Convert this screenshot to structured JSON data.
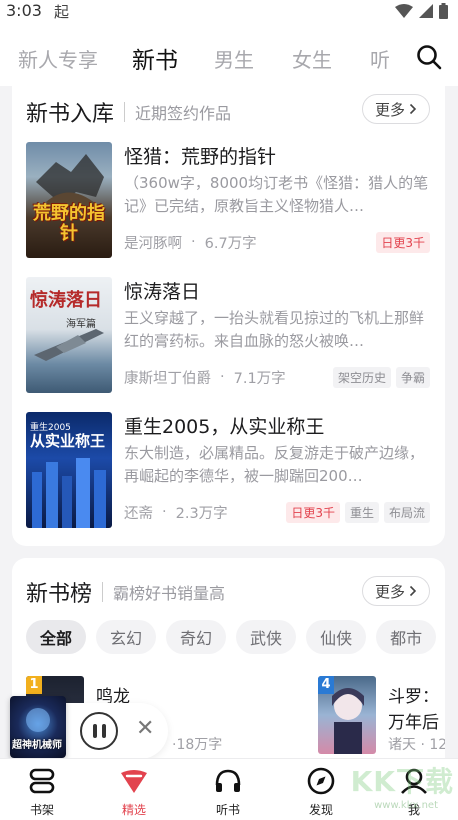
{
  "status": {
    "time": "3:03",
    "app_glyph": "起"
  },
  "tabs": [
    "新人专享",
    "新书",
    "男生",
    "女生",
    "听"
  ],
  "active_tab": "新书",
  "new_books": {
    "title": "新书入库",
    "subtitle": "近期签约作品",
    "more_label": "更多",
    "items": [
      {
        "title": "怪猎：荒野的指针",
        "desc": "（360w字，8000均订老书《怪猎：猎人的笔记》已完结，原教旨主义怪物猎人…",
        "author": "是河豚啊",
        "words": "6.7万字",
        "tags": [
          "日更3千"
        ],
        "cover_text": "荒野的指针"
      },
      {
        "title": "惊涛落日",
        "desc": "王义穿越了，一抬头就看见掠过的飞机上那鲜红的膏药标。来自血脉的怒火被唤…",
        "author": "康斯坦丁伯爵",
        "words": "7.1万字",
        "tags": [
          "架空历史",
          "争霸"
        ],
        "cover_text": "惊涛落日",
        "cover_sub": "海军篇"
      },
      {
        "title": "重生2005，从实业称王",
        "desc": "东大制造，必属精品。反复游走于破产边缘，再崛起的李德华，被一脚踹回200…",
        "author": "还斋",
        "words": "2.3万字",
        "tags": [
          "日更3千",
          "重生",
          "布局流"
        ],
        "cover_text": "从实业称王",
        "cover_sub": "重生2005"
      }
    ]
  },
  "rank": {
    "title": "新书榜",
    "subtitle": "霸榜好书销量高",
    "more_label": "更多",
    "chips": [
      "全部",
      "玄幻",
      "奇幻",
      "武侠",
      "仙侠",
      "都市"
    ],
    "active_chip": "全部",
    "left_item": {
      "rank": "1",
      "title": "鸣龙",
      "meta": "·18万字"
    },
    "right_item": {
      "rank": "4",
      "title": "斗罗：",
      "title2": "万年后",
      "meta": "诸天 · 12"
    }
  },
  "player": {
    "cover_text": "超神机械师"
  },
  "bottom_nav": [
    {
      "label": "书架",
      "icon": "bookshelf-icon"
    },
    {
      "label": "精选",
      "icon": "featured-icon"
    },
    {
      "label": "听书",
      "icon": "headphones-icon"
    },
    {
      "label": "发现",
      "icon": "compass-icon"
    },
    {
      "label": "我",
      "icon": "user-icon"
    }
  ],
  "watermark": {
    "text": "KK下载",
    "url": "www.kkx.net"
  },
  "colors": {
    "accent": "#e2434e",
    "tag_red_bg": "#fde9ea"
  }
}
